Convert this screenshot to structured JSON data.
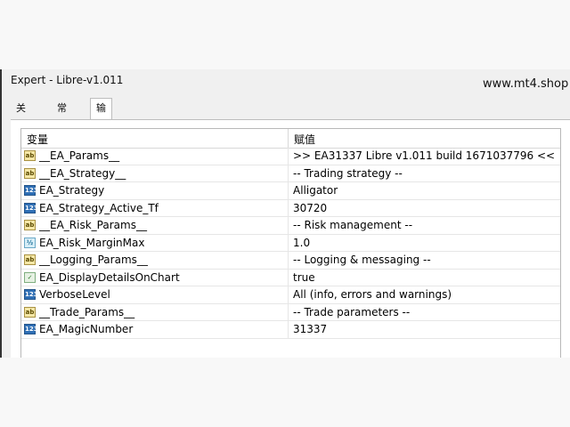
{
  "window": {
    "title": "Expert - Libre-v1.011"
  },
  "watermark": "www.mt4.shop",
  "tabs": [
    {
      "label": "关于"
    },
    {
      "label": "常用"
    },
    {
      "label": "输入参数"
    }
  ],
  "table": {
    "headers": {
      "variable": "变量",
      "value": "赋值"
    },
    "rows": [
      {
        "icon": "ab",
        "name": "__EA_Params__",
        "value": ">> EA31337 Libre v1.011 build 1671037796 <<"
      },
      {
        "icon": "ab",
        "name": "__EA_Strategy__",
        "value": "-- Trading strategy --"
      },
      {
        "icon": "123",
        "name": "EA_Strategy",
        "value": "Alligator"
      },
      {
        "icon": "123",
        "name": "EA_Strategy_Active_Tf",
        "value": "30720"
      },
      {
        "icon": "ab",
        "name": "__EA_Risk_Params__",
        "value": "-- Risk management --"
      },
      {
        "icon": "½",
        "name": "EA_Risk_MarginMax",
        "value": "1.0"
      },
      {
        "icon": "ab",
        "name": "__Logging_Params__",
        "value": "-- Logging & messaging --"
      },
      {
        "icon": "✓",
        "name": "EA_DisplayDetailsOnChart",
        "value": "true"
      },
      {
        "icon": "123",
        "name": "VerboseLevel",
        "value": "All (info, errors and warnings)"
      },
      {
        "icon": "ab",
        "name": "__Trade_Params__",
        "value": "-- Trade parameters --"
      },
      {
        "icon": "123",
        "name": "EA_MagicNumber",
        "value": "31337"
      }
    ]
  }
}
